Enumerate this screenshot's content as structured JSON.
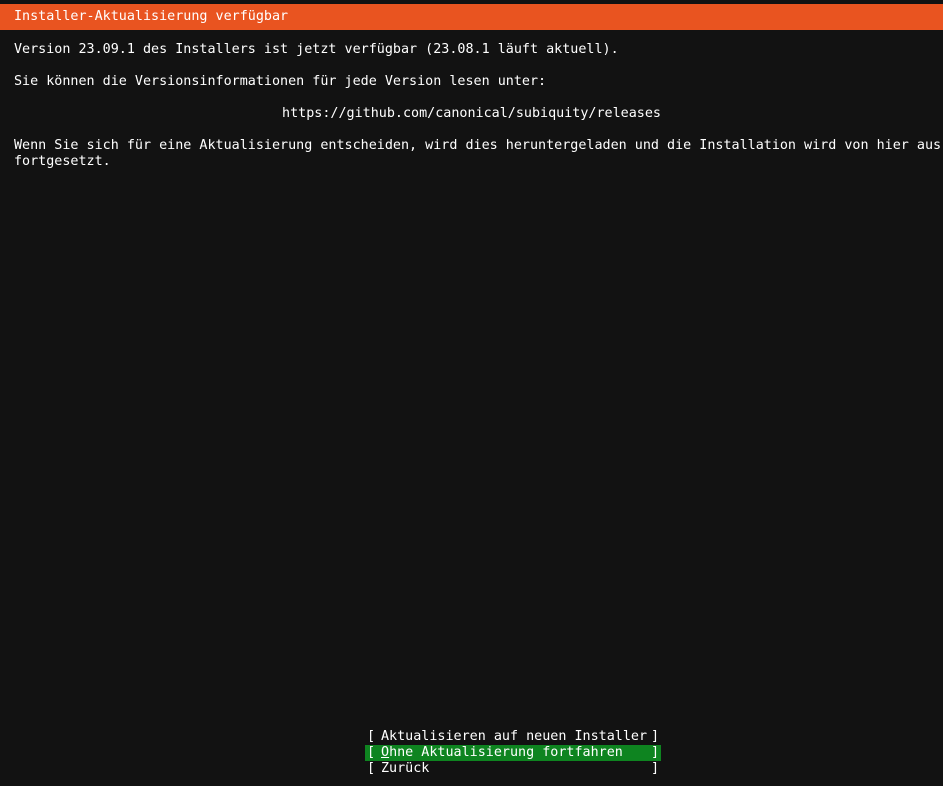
{
  "header": {
    "title": "Installer-Aktualisierung verfügbar"
  },
  "body": {
    "version_line": "Version 23.09.1 des Installers ist jetzt verfügbar (23.08.1 läuft aktuell).",
    "info_line": "Sie können die Versionsinformationen für jede Version lesen unter:",
    "releases_url": "https://github.com/canonical/subiquity/releases",
    "update_line_1": "Wenn Sie sich für eine Aktualisierung entscheiden, wird dies heruntergeladen und die Installation wird von hier aus",
    "update_line_2": "fortgesetzt."
  },
  "buttons": {
    "bracket_open": "[",
    "bracket_close": "]",
    "update_label": "Aktualisieren auf neuen Installer",
    "continue_first": "O",
    "continue_rest": "hne Aktualisierung fortfahren",
    "back_label": "Zurück"
  },
  "colors": {
    "header_bg": "#e95420",
    "background": "#121212",
    "focused_button_bg": "#0e8420",
    "text": "#ffffff"
  }
}
